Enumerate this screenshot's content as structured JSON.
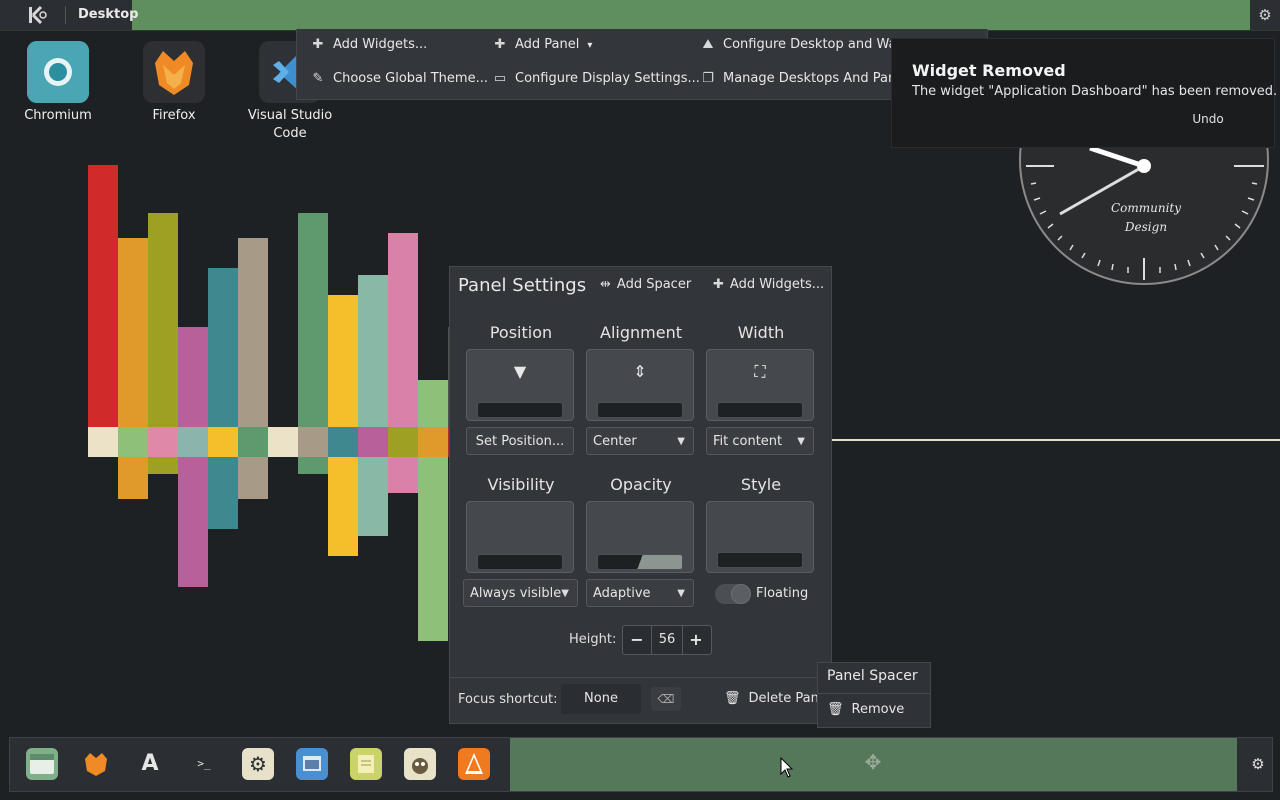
{
  "top_panel": {
    "title": "Desktop",
    "logo_icon": "kde-logo-icon",
    "settings_icon": "gear-icon"
  },
  "desktop_icons": [
    {
      "label": "Chromium",
      "icon": "chromium-icon"
    },
    {
      "label": "Firefox",
      "icon": "firefox-icon"
    },
    {
      "label": "Visual Studio\nCode",
      "icon": "vscode-icon"
    }
  ],
  "context_toolbar": {
    "add_widgets": "Add Widgets...",
    "add_panel": "Add Panel",
    "configure_desktop": "Configure Desktop and Wal",
    "choose_theme": "Choose Global Theme...",
    "configure_display": "Configure Display Settings...",
    "manage_desktops": "Manage Desktops And Pane"
  },
  "notification": {
    "title": "Widget Removed",
    "body": "The widget \"Application Dashboard\" has been removed.",
    "undo": "Undo"
  },
  "clock": {
    "brand_line1": "Community",
    "brand_line2": "Design"
  },
  "panel_settings": {
    "title": "Panel Settings",
    "add_spacer": "Add Spacer",
    "add_widgets": "Add Widgets...",
    "position": {
      "label": "Position",
      "button": "Set Position..."
    },
    "alignment": {
      "label": "Alignment",
      "value": "Center"
    },
    "width": {
      "label": "Width",
      "value": "Fit content"
    },
    "visibility": {
      "label": "Visibility",
      "value": "Always visible"
    },
    "opacity": {
      "label": "Opacity",
      "value": "Adaptive"
    },
    "style": {
      "label": "Style",
      "toggle_label": "Floating"
    },
    "height": {
      "label": "Height:",
      "value": "56"
    },
    "focus_shortcut": {
      "label": "Focus shortcut:",
      "value": "None"
    },
    "delete_panel": "Delete Pane"
  },
  "popup": {
    "title": "Panel Spacer",
    "remove": "Remove"
  },
  "taskbar": {
    "items": [
      {
        "name": "file-manager-icon",
        "bg": "#7fb08a"
      },
      {
        "name": "firefox-icon",
        "bg": "#2b2f33"
      },
      {
        "name": "app-store-icon",
        "bg": "#2b2f33"
      },
      {
        "name": "terminal-icon",
        "bg": "#2b2f33"
      },
      {
        "name": "settings-icon",
        "bg": "#e6e1c8"
      },
      {
        "name": "image-viewer-icon",
        "bg": "#4a90d0"
      },
      {
        "name": "notes-icon",
        "bg": "#c9d36a"
      },
      {
        "name": "gimp-icon",
        "bg": "#e8e2c8"
      },
      {
        "name": "vlc-icon",
        "bg": "#f07a20"
      }
    ]
  },
  "colors": {
    "panel_green": "#5f8f5f",
    "bottom_green": "#56785a",
    "dark": "#2b2f33"
  }
}
